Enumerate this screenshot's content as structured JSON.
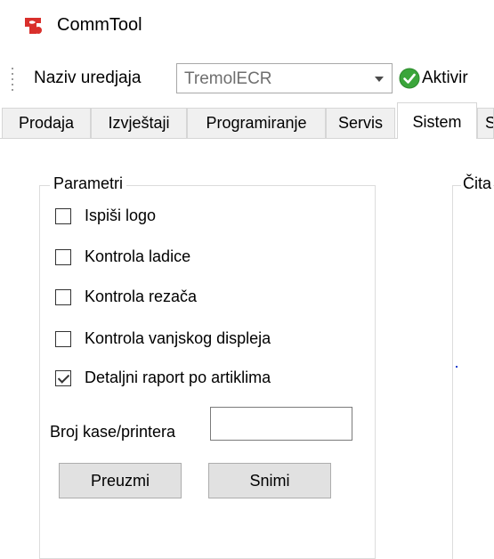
{
  "app": {
    "title": "CommTool",
    "icon": "commtool-logo-icon",
    "icon_color": "#d9302c"
  },
  "toolbar": {
    "device_label": "Naziv uredjaja",
    "device_value": "TremolECR",
    "active_label": "Aktivir",
    "active_icon": "check-circle-icon",
    "active_icon_color": "#3aa53a"
  },
  "tabs": [
    {
      "label": "Prodaja",
      "active": false
    },
    {
      "label": "Izvještaji",
      "active": false
    },
    {
      "label": "Programiranje",
      "active": false
    },
    {
      "label": "Servis",
      "active": false
    },
    {
      "label": "Sistem",
      "active": true
    },
    {
      "label": "S",
      "active": false
    }
  ],
  "parametri": {
    "legend": "Parametri",
    "options": [
      {
        "label": "Ispiši logo",
        "checked": false
      },
      {
        "label": "Kontrola ladice",
        "checked": false
      },
      {
        "label": "Kontrola rezača",
        "checked": false
      },
      {
        "label": "Kontrola vanjskog displeja",
        "checked": false
      },
      {
        "label": "Detaljni raport po artiklima",
        "checked": true
      }
    ],
    "printer_label": "Broj kase/printera",
    "printer_value": "",
    "download_button": "Preuzmi",
    "save_button": "Snimi"
  },
  "read_panel": {
    "legend": "Čita"
  }
}
